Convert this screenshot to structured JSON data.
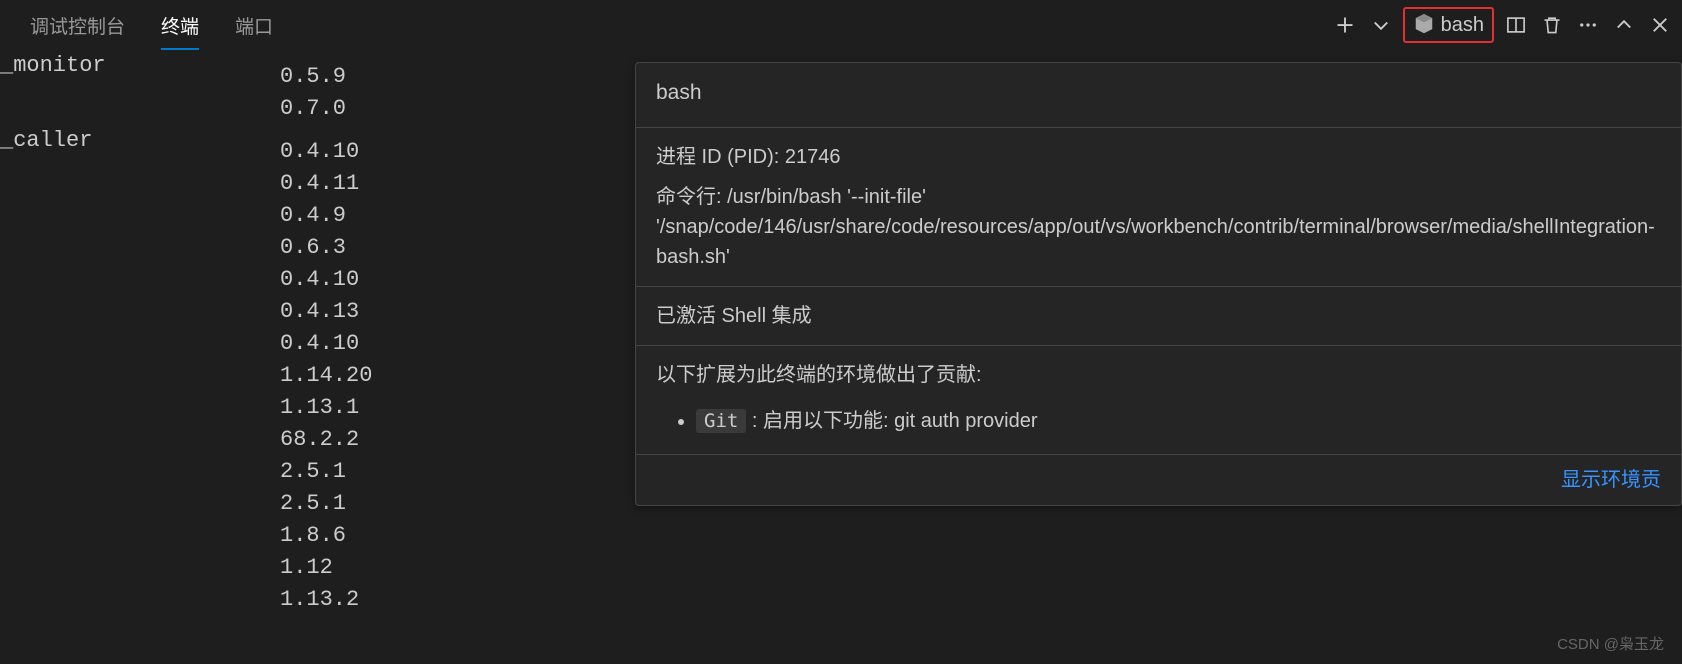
{
  "tabs": {
    "debug": "调试控制台",
    "terminal": "终端",
    "ports": "端口"
  },
  "toolbar": {
    "bash_label": "bash"
  },
  "terminal_rows": [
    {
      "name": "_monitor",
      "version": "0.5.9"
    },
    {
      "name": "",
      "version": "0.7.0"
    },
    {
      "name": "_caller",
      "version": "0.4.10"
    },
    {
      "name": "",
      "version": "0.4.11"
    },
    {
      "name": "",
      "version": "0.4.9"
    },
    {
      "name": "",
      "version": "0.6.3"
    },
    {
      "name": "",
      "version": "0.4.10"
    },
    {
      "name": "",
      "version": "0.4.13"
    },
    {
      "name": "",
      "version": "0.4.10"
    },
    {
      "name": "",
      "version": "1.14.20"
    },
    {
      "name": "",
      "version": "1.13.1"
    },
    {
      "name": "",
      "version": "68.2.2"
    },
    {
      "name": "",
      "version": "2.5.1"
    },
    {
      "name": "",
      "version": "2.5.1"
    },
    {
      "name": "",
      "version": "1.8.6"
    },
    {
      "name": "",
      "version": "1.12"
    },
    {
      "name": "",
      "version": "1.13.2"
    }
  ],
  "tooltip": {
    "title": "bash",
    "pid_label": "进程 ID (PID): 21746",
    "cmdline": "命令行: /usr/bin/bash '--init-file' '/snap/code/146/usr/share/code/resources/app/out/vs/workbench/contrib/terminal/browser/media/shellIntegration-bash.sh'",
    "shell_integration": "已激活 Shell 集成",
    "contrib_heading": "以下扩展为此终端的环境做出了贡献:",
    "git_label": "Git",
    "git_desc": " : 启用以下功能: git auth provider",
    "link": "显示环境贡"
  },
  "watermark": "CSDN @枭玉龙"
}
